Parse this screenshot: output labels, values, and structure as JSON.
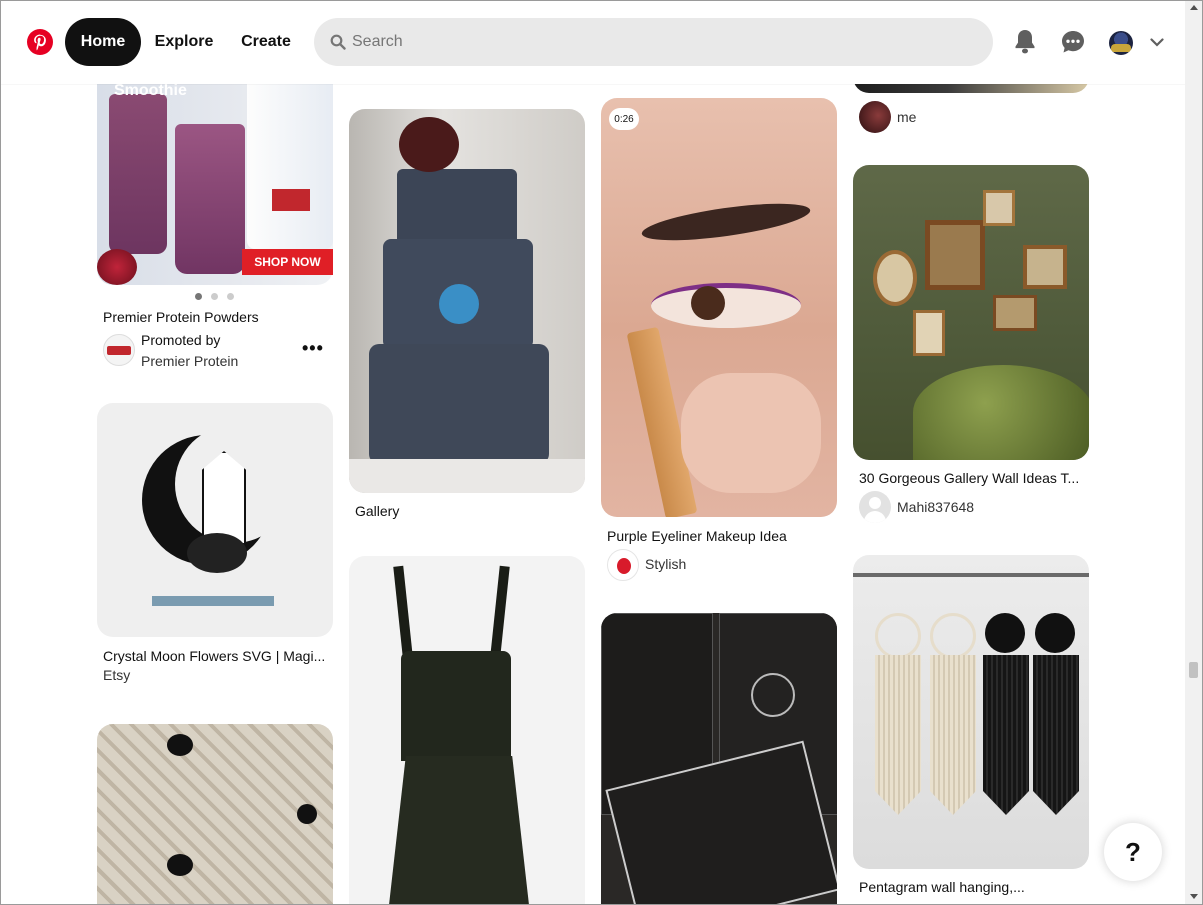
{
  "header": {
    "nav": {
      "home": "Home",
      "explore": "Explore",
      "create": "Create"
    },
    "search_placeholder": "Search"
  },
  "pins": {
    "protein": {
      "overlay_title": "Smoothie",
      "badge": "SHOP NOW",
      "title": "Premier Protein Powders",
      "promoted_label": "Promoted by",
      "advertiser": "Premier Protein"
    },
    "crystal_moon": {
      "title": "Crystal Moon Flowers SVG | Magi...",
      "source": "Etsy"
    },
    "cake": {
      "title": "Gallery"
    },
    "eyeliner": {
      "duration": "0:26",
      "title": "Purple Eyeliner Makeup Idea",
      "user": "Stylish"
    },
    "top_right": {
      "user": "me"
    },
    "gallery_wall": {
      "title": "30 Gorgeous Gallery Wall Ideas T...",
      "user": "Mahi837648"
    },
    "pentagram": {
      "title": "Pentagram wall hanging,..."
    }
  },
  "help_label": "?",
  "colors": {
    "brand": "#e60023",
    "home_active_bg": "#111111",
    "search_bg": "#e9e9e9"
  },
  "icons": [
    "pinterest-logo",
    "search-icon",
    "bell-icon",
    "messages-icon",
    "avatar",
    "chevron-down-icon",
    "more-icon",
    "help-icon"
  ]
}
